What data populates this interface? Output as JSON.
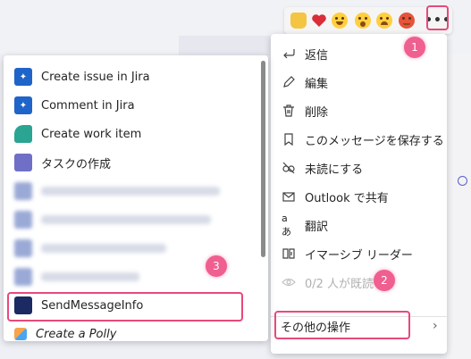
{
  "reactions": [
    "like",
    "heart",
    "laugh",
    "surprised",
    "sad",
    "angry"
  ],
  "more_options_glyph": "•••",
  "right_menu": {
    "items": [
      {
        "label": "返信",
        "icon": "reply-icon"
      },
      {
        "label": "編集",
        "icon": "edit-icon"
      },
      {
        "label": "削除",
        "icon": "delete-icon"
      },
      {
        "label": "このメッセージを保存する",
        "icon": "bookmark-icon"
      },
      {
        "label": "未読にする",
        "icon": "mark-unread-icon"
      },
      {
        "label": "Outlook で共有",
        "icon": "mail-icon"
      },
      {
        "label": "翻訳",
        "icon": "translate-icon"
      },
      {
        "label": "イマーシブ リーダー",
        "icon": "immersive-reader-icon"
      },
      {
        "label": "0/2 人が既読",
        "icon": "eye-icon"
      }
    ],
    "more_actions": "その他の操作"
  },
  "left_menu": {
    "items": [
      {
        "label": "Create issue in Jira",
        "icon": "jira-icon"
      },
      {
        "label": "Comment in Jira",
        "icon": "jira-icon"
      },
      {
        "label": "Create work item",
        "icon": "work-item-icon"
      },
      {
        "label": "タスクの作成",
        "icon": "task-icon"
      }
    ],
    "send_message": "SendMessageInfo",
    "create_polly": "Create a Polly"
  },
  "badges": {
    "one": "1",
    "two": "2",
    "three": "3"
  },
  "colors": {
    "highlight": "#e8497a",
    "badge": "#ef5f8f"
  }
}
